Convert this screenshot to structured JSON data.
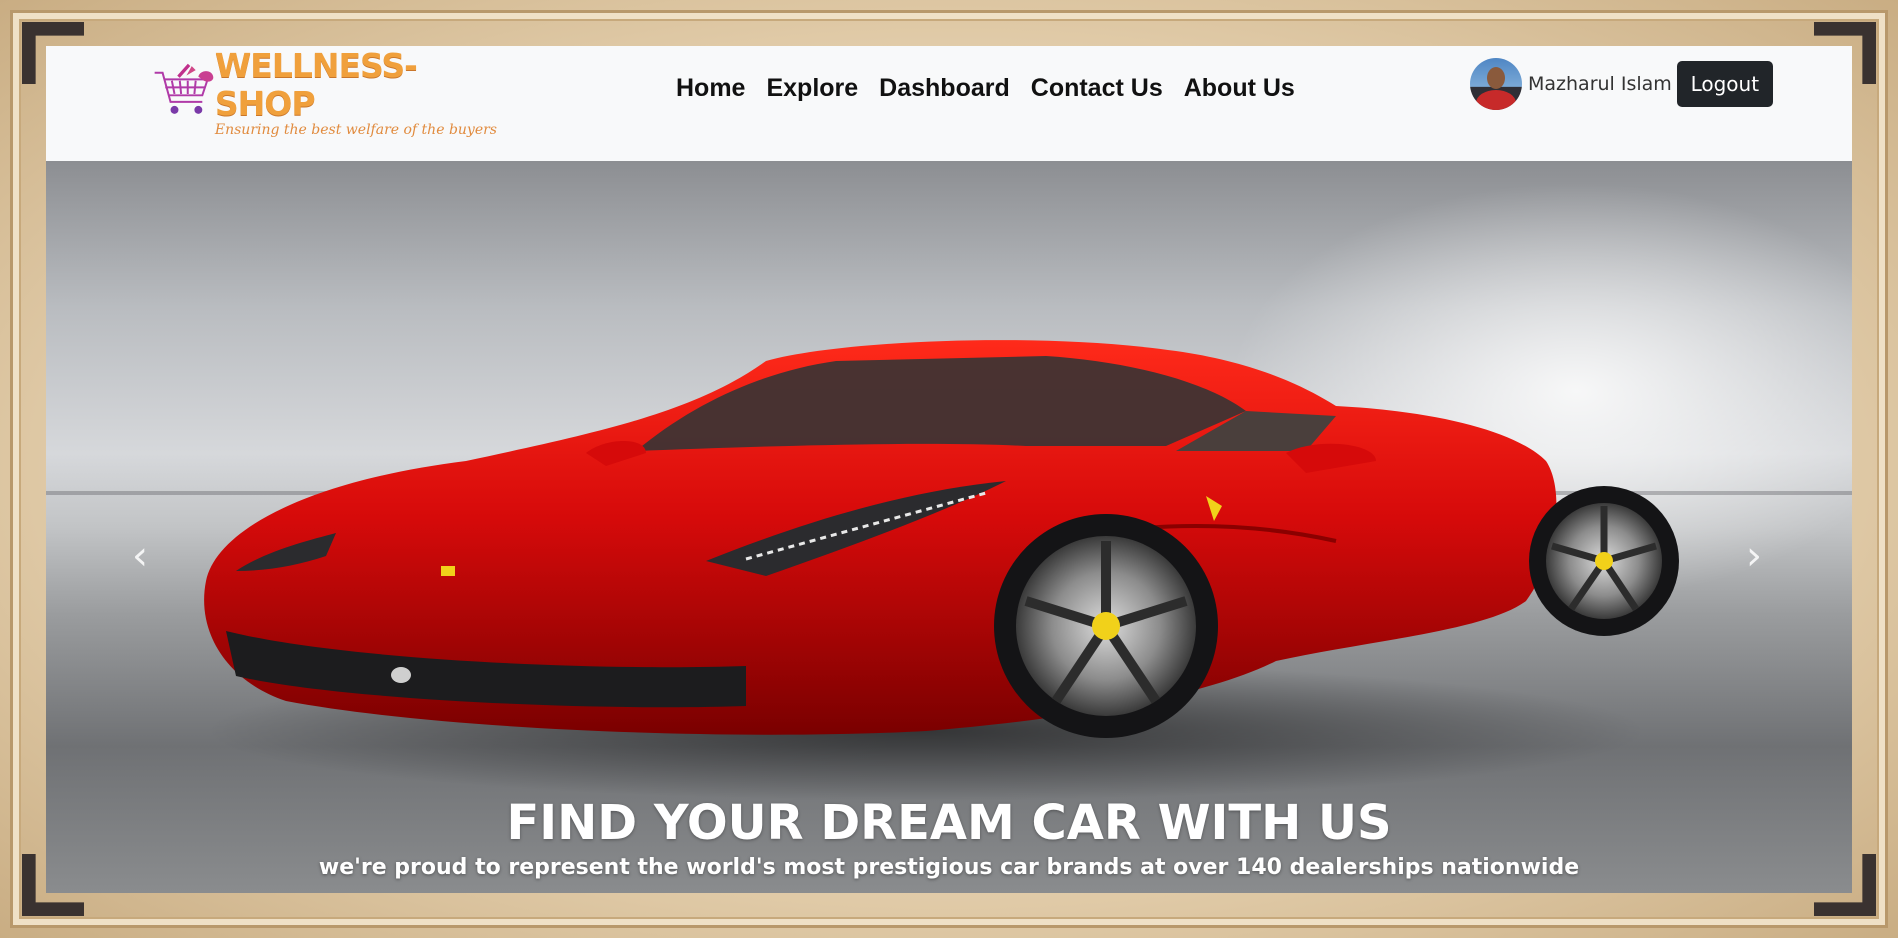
{
  "brand": {
    "name": "WELLNESS-SHOP",
    "tagline": "Ensuring the best welfare of the buyers",
    "icon": "shopping-cart-logo"
  },
  "nav": {
    "items": [
      {
        "label": "Home"
      },
      {
        "label": "Explore"
      },
      {
        "label": "Dashboard"
      },
      {
        "label": "Contact Us"
      },
      {
        "label": "About Us"
      }
    ]
  },
  "user": {
    "name": "Mazharul Islam",
    "logout_label": "Logout"
  },
  "hero": {
    "title": "FIND YOUR DREAM CAR WITH US",
    "subtitle": "we're proud to represent the world's most prestigious car brands at over 140 dealerships nationwide",
    "prev_icon": "chevron-left-icon",
    "next_icon": "chevron-right-icon",
    "prev_glyph": "‹",
    "next_glyph": "›"
  },
  "colors": {
    "navbar_bg": "#f8f9fa",
    "logout_bg": "#212529",
    "brand_orange": "#f0a03c",
    "car_red": "#d60a0a"
  }
}
